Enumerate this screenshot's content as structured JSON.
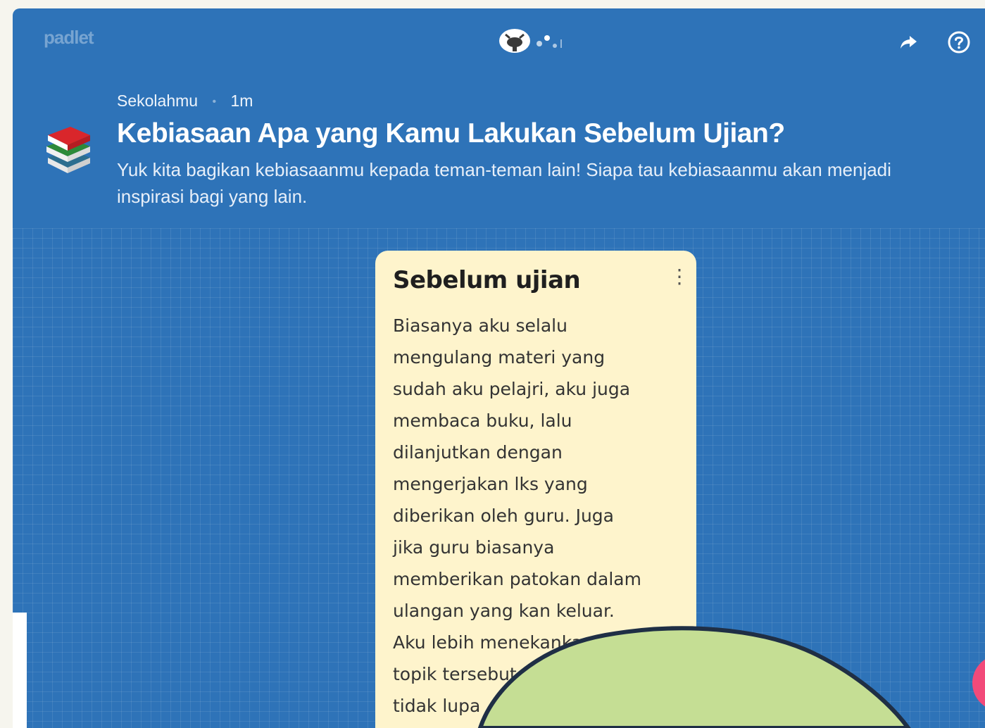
{
  "header": {
    "brand": "padlet",
    "author": "Sekolahmu",
    "time": "1m",
    "separator": "•",
    "title": "Kebiasaan Apa yang Kamu Lakukan Sebelum Ujian?",
    "subtitle": "Yuk kita bagikan kebiasaanmu kepada teman-teman lain! Siapa tau kebiasaanmu akan menjadi inspirasi bagi yang lain."
  },
  "post": {
    "title": "Sebelum ujian",
    "menu_glyph": "⋮",
    "lines": [
      "Biasanya aku selalu",
      "mengulang materi yang",
      "sudah aku pelajri, aku juga",
      "membaca buku, lalu",
      "dilanjutkan dengan",
      "mengerjakan lks yang",
      "diberikan oleh guru. Juga",
      "jika guru biasanya",
      "memberikan patokan dalam",
      "ulangan yang kan keluar.",
      "Aku lebih menekankan pada",
      "topik tersebut. Aku",
      "tidak lupa"
    ]
  },
  "icons": {
    "share": "share-arrow-icon",
    "help": "help-circle-icon",
    "avatar": "avatar-icon",
    "typing": "typing-dots-icon",
    "wall": "books-icon"
  },
  "colors": {
    "wall_blue": "#2e73b8",
    "card_bg": "#fef4cc",
    "blob_green": "#c5de94",
    "fab_pink": "#f24a7a"
  }
}
